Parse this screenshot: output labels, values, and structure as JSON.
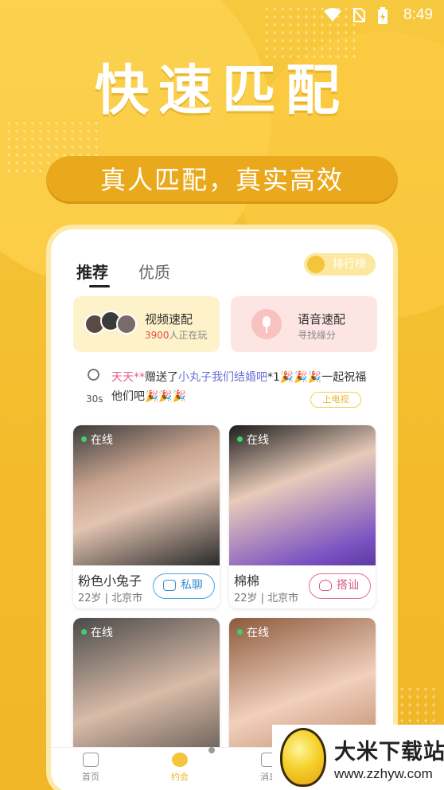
{
  "status_bar": {
    "time": "8:49"
  },
  "hero": {
    "headline": "快速匹配",
    "tagline": "真人匹配，真实高效"
  },
  "tabs": [
    {
      "label": "推荐"
    },
    {
      "label": "优质"
    }
  ],
  "rank_button": {
    "label": "排行榜"
  },
  "match_cards": [
    {
      "title": "视频速配",
      "count": "3900",
      "count_suffix": "人正在玩"
    },
    {
      "title": "语音速配",
      "subtitle": "寻找缘分"
    }
  ],
  "ticker": {
    "user": "天天**",
    "verb": "赠送了",
    "gift": "小丸子我们结婚吧",
    "qty": "*1",
    "tail": "🎉🎉🎉一起祝福他们吧🎉🎉🎉",
    "timer": "30s",
    "tv_button": "上电视"
  },
  "profiles": [
    {
      "status": "在线",
      "name": "粉色小兔子",
      "meta": "22岁 | 北京市",
      "action": "私聊"
    },
    {
      "status": "在线",
      "name": "棉棉",
      "meta": "22岁 | 北京市",
      "action": "搭讪"
    },
    {
      "status": "在线"
    },
    {
      "status": "在线"
    }
  ],
  "bottom_nav": [
    {
      "label": "首页"
    },
    {
      "label": "约会"
    },
    {
      "label": "消息"
    }
  ],
  "watermark": {
    "title": "大米下载站",
    "url": "www.zzhyw.com"
  },
  "colors": {
    "accent": "#f4c43b",
    "online": "#3fd06b",
    "chat": "#4aa3e0",
    "talk": "#e06e8f"
  }
}
